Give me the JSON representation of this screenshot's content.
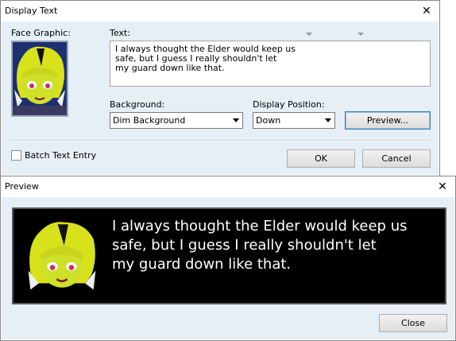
{
  "display_text_window": {
    "title": "Display Text",
    "close_glyph": "✕",
    "face_graphic_label": "Face Graphic:",
    "text_label": "Text:",
    "text_value": "I always thought the Elder would keep us\nsafe, but I guess I really shouldn't let\nmy guard down like that.",
    "background_label": "Background:",
    "background_value": "Dim Background",
    "display_position_label": "Display Position:",
    "display_position_value": "Down",
    "preview_button": "Preview...",
    "batch_text_entry_label": "Batch Text Entry",
    "batch_text_entry_checked": false,
    "ok_button": "OK",
    "cancel_button": "Cancel"
  },
  "preview_window": {
    "title": "Preview",
    "close_glyph": "✕",
    "message_text": "I always thought the Elder would keep us\nsafe, but I guess I really shouldn't let\nmy guard down like that.",
    "close_button": "Close"
  },
  "colors": {
    "client_background": "#e6eef6",
    "preview_message_background": "#000000",
    "face_hair": "#d8e21a",
    "face_skin": "#cfe02a"
  },
  "icons": [
    "close-icon",
    "dropdown-arrow-icon",
    "face-portrait"
  ]
}
